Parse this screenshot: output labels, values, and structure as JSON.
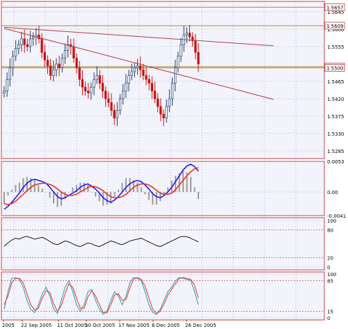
{
  "chart_data": [
    {
      "type": "candlestick",
      "panel": "price",
      "ylim": [
        1.5265,
        1.5672
      ],
      "y_ticks": [
        "1.5645",
        "1.5600",
        "1.5555",
        "1.5465",
        "1.5420",
        "1.5375",
        "1.5330",
        "1.5285"
      ],
      "highlighted_levels": [
        {
          "label": "1.5657",
          "value": 1.5657
        },
        {
          "label": "1.5609",
          "value": 1.5609
        },
        {
          "label": "1.5503",
          "value": 1.5503
        },
        {
          "label": "1.5500",
          "value": 1.55
        }
      ],
      "closes": [
        1.544,
        1.547,
        1.55,
        1.553,
        1.555,
        1.556,
        1.5575,
        1.556,
        1.5555,
        1.5575,
        1.558,
        1.5585,
        1.5575,
        1.554,
        1.552,
        1.5505,
        1.548,
        1.5495,
        1.551,
        1.55,
        1.5525,
        1.5545,
        1.556,
        1.5555,
        1.5525,
        1.55,
        1.547,
        1.545,
        1.544,
        1.5435,
        1.545,
        1.547,
        1.548,
        1.546,
        1.544,
        1.542,
        1.541,
        1.539,
        1.537,
        1.539,
        1.542,
        1.544,
        1.546,
        1.548,
        1.549,
        1.55,
        1.5505,
        1.5495,
        1.548,
        1.547,
        1.546,
        1.544,
        1.542,
        1.54,
        1.538,
        1.537,
        1.54,
        1.542,
        1.546,
        1.55,
        1.553,
        1.556,
        1.5585,
        1.559,
        1.558,
        1.557,
        1.554,
        1.551
      ],
      "trendlines": [
        {
          "from": [
            0,
            1.5605
          ],
          "to": [
            93,
            1.5557
          ],
          "color": "#b04040"
        },
        {
          "from": [
            0,
            1.5602
          ],
          "to": [
            93,
            1.5418
          ],
          "color": "#b04040"
        }
      ]
    },
    {
      "type": "line",
      "panel": "macd",
      "y_ticks": [
        "0.0053",
        "0.00",
        "-0.0041"
      ],
      "series": [
        {
          "color": "#1a1aff",
          "values": [
            -0.003,
            -0.0025,
            -0.0018,
            -0.001,
            -0.0002,
            0.0008,
            0.0015,
            0.002,
            0.0022,
            0.002,
            0.0018,
            0.0015,
            0.0008,
            0.0,
            -0.0008,
            -0.0012,
            -0.001,
            -0.0006,
            -0.0002,
            0.0002,
            0.0008,
            0.0012,
            0.0014,
            0.001,
            0.0005,
            -0.0002,
            -0.001,
            -0.0015,
            -0.0018,
            -0.0014,
            -0.0008,
            0.0,
            0.0008,
            0.0014,
            0.0018,
            0.002,
            0.0018,
            0.0012,
            0.0005,
            -0.0003,
            -0.0008,
            -0.001,
            -0.0006,
            0.0,
            0.0008,
            0.0018,
            0.0028,
            0.0038,
            0.0045,
            0.0048,
            0.0044,
            0.0036
          ]
        },
        {
          "color": "#e83020",
          "values": [
            -0.002,
            -0.0022,
            -0.002,
            -0.0016,
            -0.001,
            -0.0004,
            0.0002,
            0.0008,
            0.0012,
            0.0014,
            0.0015,
            0.0015,
            0.0013,
            0.001,
            0.0005,
            0.0,
            -0.0004,
            -0.0006,
            -0.0006,
            -0.0004,
            0.0,
            0.0004,
            0.0008,
            0.001,
            0.0009,
            0.0006,
            0.0002,
            -0.0004,
            -0.0008,
            -0.001,
            -0.001,
            -0.0008,
            -0.0004,
            0.0002,
            0.0008,
            0.0012,
            0.0014,
            0.0014,
            0.0012,
            0.0008,
            0.0003,
            -0.0002,
            -0.0004,
            -0.0004,
            -0.0002,
            0.0004,
            0.0012,
            0.002,
            0.0028,
            0.0035,
            0.004,
            0.0042
          ]
        }
      ]
    },
    {
      "type": "line",
      "panel": "rsi",
      "y_ticks": [
        "100",
        "80",
        "20",
        "0"
      ],
      "ylim": [
        0,
        100
      ],
      "series": [
        {
          "color": "#000000",
          "values": [
            45,
            52,
            58,
            62,
            60,
            64,
            66,
            63,
            60,
            62,
            64,
            60,
            55,
            50,
            48,
            52,
            56,
            54,
            50,
            46,
            44,
            48,
            52,
            50,
            46,
            44,
            48,
            52,
            56,
            54,
            50,
            48,
            52,
            56,
            58,
            60,
            62,
            58,
            54,
            50,
            46,
            44,
            48,
            52,
            56,
            60,
            64,
            66,
            65,
            62,
            58,
            54
          ]
        }
      ]
    },
    {
      "type": "line",
      "panel": "stochastic",
      "y_ticks": [
        "100",
        "85",
        "15",
        "0"
      ],
      "ylim": [
        0,
        100
      ],
      "series": [
        {
          "color": "#20a0a0",
          "values": [
            20,
            60,
            90,
            92,
            88,
            70,
            40,
            20,
            12,
            30,
            55,
            70,
            50,
            20,
            10,
            40,
            70,
            85,
            60,
            30,
            15,
            30,
            60,
            65,
            40,
            20,
            8,
            15,
            40,
            60,
            50,
            30,
            50,
            80,
            92,
            90,
            85,
            60,
            30,
            12,
            8,
            20,
            40,
            60,
            70,
            85,
            92,
            90,
            88,
            85,
            60,
            30
          ]
        },
        {
          "color": "#e83020",
          "values": [
            30,
            50,
            80,
            90,
            90,
            80,
            55,
            30,
            18,
            22,
            45,
            62,
            58,
            32,
            15,
            28,
            55,
            78,
            70,
            45,
            22,
            22,
            48,
            62,
            50,
            30,
            12,
            12,
            30,
            52,
            55,
            40,
            42,
            68,
            88,
            92,
            88,
            72,
            45,
            20,
            10,
            15,
            32,
            52,
            65,
            78,
            90,
            92,
            90,
            88,
            75,
            45
          ]
        }
      ]
    }
  ],
  "x_axis_labels": [
    "2005",
    "22 Sep 2005",
    "11 Oct 2005",
    "30 Oct 2005",
    "17 Nov 2005",
    "6 Dec 2005",
    "26 Dec 2005"
  ],
  "colors": {
    "background": "#f3f3fb",
    "grid": "#7070c0",
    "level_highlight": "#b08a30",
    "bull": "#1a3a6a",
    "bear": "#cc1010",
    "ob_os_lines": "#c03030"
  }
}
